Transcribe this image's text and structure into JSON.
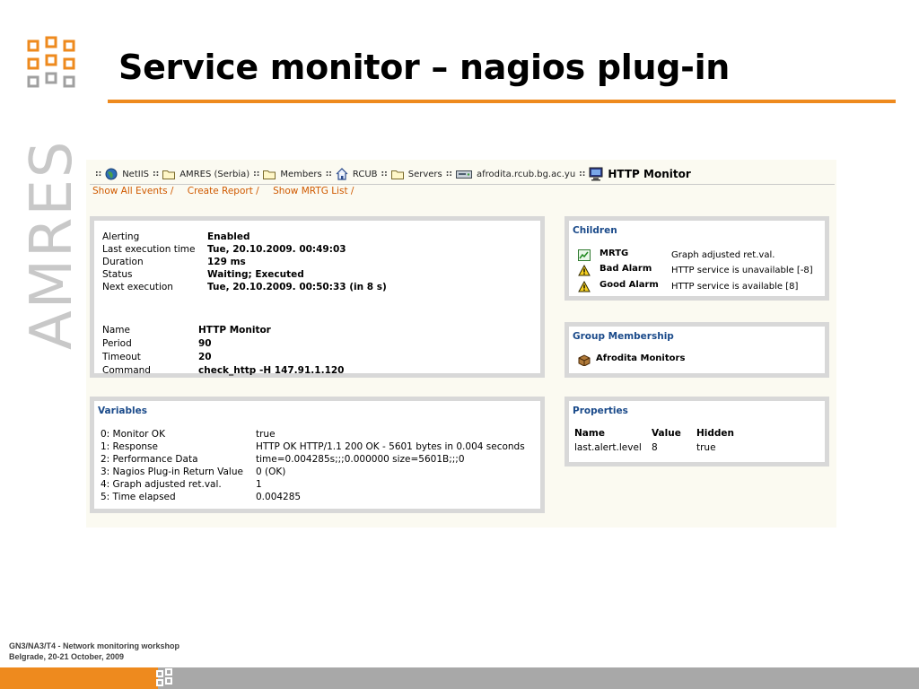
{
  "slide": {
    "title": "Service monitor – nagios plug-in",
    "brand": "AMRES",
    "footer_line1": "GN3/NA3/T4 - Network monitoring workshop",
    "footer_line2": "Belgrade, 20-21 October, 2009",
    "accent_color": "#ee8a1e"
  },
  "breadcrumb": {
    "items": [
      {
        "label": "NetIIS",
        "icon": "globe-icon"
      },
      {
        "label": "AMRES (Serbia)",
        "icon": "folder-icon"
      },
      {
        "label": "Members",
        "icon": "folder-icon"
      },
      {
        "label": "RCUB",
        "icon": "house-icon"
      },
      {
        "label": "Servers",
        "icon": "folder-icon"
      },
      {
        "label": "afrodita.rcub.bg.ac.yu",
        "icon": "server-icon"
      }
    ],
    "current": "HTTP Monitor",
    "current_icon": "monitor-icon"
  },
  "links": [
    "Show All Events /",
    "Create Report /",
    "Show MRTG List /"
  ],
  "status": {
    "rows": [
      {
        "label": "Alerting",
        "value": "Enabled"
      },
      {
        "label": "Last execution time",
        "value": "Tue, 20.10.2009. 00:49:03"
      },
      {
        "label": "Duration",
        "value": "129 ms"
      },
      {
        "label": "Status",
        "value": "Waiting; Executed"
      },
      {
        "label": "Next execution",
        "value": "Tue, 20.10.2009. 00:50:33 (in 8 s)"
      }
    ],
    "config_rows": [
      {
        "label": "Name",
        "value": "HTTP Monitor"
      },
      {
        "label": "Period",
        "value": "90"
      },
      {
        "label": "Timeout",
        "value": "20"
      },
      {
        "label": "Command",
        "value": "check_http -H 147.91.1.120"
      }
    ]
  },
  "variables": {
    "title": "Variables",
    "rows": [
      {
        "name": "0: Monitor OK",
        "value": "true"
      },
      {
        "name": "1: Response",
        "value": "HTTP OK HTTP/1.1 200 OK - 5601 bytes in 0.004 seconds"
      },
      {
        "name": "2: Performance Data",
        "value": "time=0.004285s;;;0.000000 size=5601B;;;0"
      },
      {
        "name": "3: Nagios Plug-in Return Value",
        "value": "0 (OK)"
      },
      {
        "name": "4: Graph adjusted ret.val.",
        "value": "1"
      },
      {
        "name": "5: Time elapsed",
        "value": "0.004285"
      }
    ]
  },
  "children": {
    "title": "Children",
    "items": [
      {
        "name": "MRTG",
        "desc": "Graph adjusted ret.val.",
        "icon": "graph-icon"
      },
      {
        "name": "Bad Alarm",
        "desc": "HTTP service is unavailable [-8]",
        "icon": "warning-icon"
      },
      {
        "name": "Good Alarm",
        "desc": "HTTP service is available [8]",
        "icon": "warning-icon"
      }
    ]
  },
  "group_membership": {
    "title": "Group Membership",
    "items": [
      {
        "name": "Afrodita Monitors",
        "icon": "box-icon"
      }
    ]
  },
  "properties": {
    "title": "Properties",
    "headers": [
      "Name",
      "Value",
      "Hidden"
    ],
    "rows": [
      {
        "name": "last.alert.level",
        "value": "8",
        "hidden": "true"
      }
    ]
  }
}
